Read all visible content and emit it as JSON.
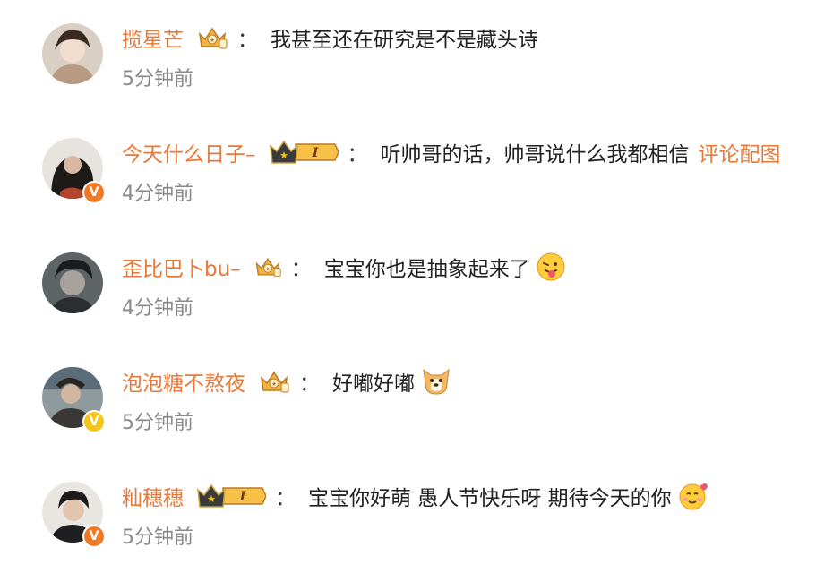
{
  "comments": [
    {
      "user": "揽星芒",
      "badge": "crown-small",
      "text": "我甚至还在研究是不是藏头诗",
      "time": "5分钟前",
      "verified": null,
      "link": null,
      "emoji": null
    },
    {
      "user": "今天什么日子–",
      "badge": "crown-level",
      "badge_level": "I",
      "text": "听帅哥的话，帅哥说什么我都相信",
      "time": "4分钟前",
      "verified": "orange",
      "link": "评论配图",
      "emoji": null
    },
    {
      "user": "歪比巴卜bu–",
      "badge": "crown-small",
      "text": "宝宝你也是抽象起来了",
      "time": "4分钟前",
      "verified": null,
      "link": null,
      "emoji": "tongue-face-emoji"
    },
    {
      "user": "泡泡糖不熬夜",
      "badge": "crown-small",
      "text": "好嘟好嘟",
      "time": "5分钟前",
      "verified": "yellow",
      "link": null,
      "emoji": "dog-face-emoji"
    },
    {
      "user": "籼穗穗",
      "badge": "crown-level",
      "badge_level": "I",
      "text": "宝宝你好萌 愚人节快乐呀 期待今天的你",
      "time": "5分钟前",
      "verified": "orange",
      "link": null,
      "emoji": "hug-face-emoji"
    }
  ],
  "verified_mark": "V",
  "separator": "：",
  "colors": {
    "username": "#e8793a",
    "time": "#8a8a8a",
    "text": "#222222",
    "verified_orange": "#f07a24",
    "verified_yellow": "#f5c518"
  }
}
